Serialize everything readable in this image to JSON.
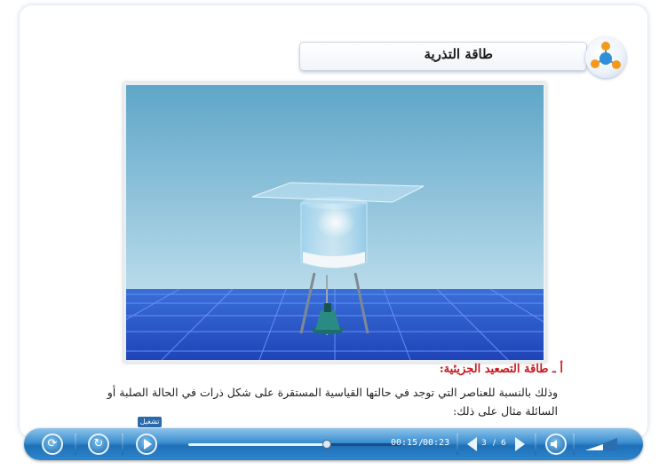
{
  "header": {
    "title": "طاقة التذرية",
    "icon": "molecule-icon"
  },
  "content": {
    "subheading": "أ ـ طاقة التصعيد الجزيئية:",
    "paragraph": "وذلك بالنسبة للعناصر التي توجد في حالتها القياسية المستقرة على شكل ذرات في الحالة الصلبة أو السائلة مثال على ذلك:"
  },
  "player": {
    "tooltip": "تشغيل",
    "current_time": "00:15",
    "total_time": "00:23",
    "progress": 0.65,
    "page_current": "3",
    "page_sep": "/",
    "page_total": "6",
    "buttons": [
      "refresh-icon",
      "replay-icon",
      "play-icon",
      "volume-icon",
      "volume-level-icon"
    ]
  },
  "colors": {
    "accent": "#2a7fc9",
    "heading_red": "#c8191f"
  }
}
